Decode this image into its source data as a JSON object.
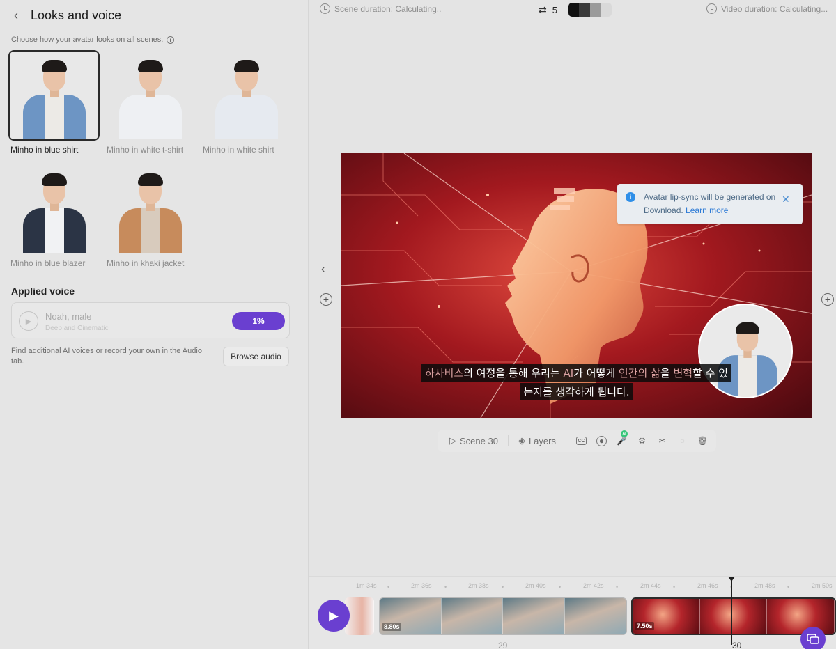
{
  "panel": {
    "title": "Looks and voice",
    "subtitle": "Choose how your avatar looks on all scenes.",
    "looks": [
      {
        "label": "Minho in blue shirt",
        "selected": true,
        "outfit": "#6d95c4",
        "inner": "#eceae6"
      },
      {
        "label": "Minho in white t-shirt",
        "selected": false,
        "outfit": "#eef0f3",
        "inner": "#eef0f3"
      },
      {
        "label": "Minho in white shirt",
        "selected": false,
        "outfit": "#e9edf2",
        "inner": "#e9edf2"
      },
      {
        "label": "Minho in blue blazer",
        "selected": false,
        "outfit": "#2b3445",
        "inner": "#f1f2f4"
      },
      {
        "label": "Minho in khaki jacket",
        "selected": false,
        "outfit": "#c78b5c",
        "inner": "#d8cbbd"
      }
    ],
    "voice_title": "Applied voice",
    "voice": {
      "name": "Noah, male",
      "description": "Deep and Cinematic",
      "progress_label": "1%"
    },
    "find_text": "Find additional AI voices or record your own in the Audio tab.",
    "browse_label": "Browse audio"
  },
  "topbar": {
    "scene_duration": "Scene duration: Calculating..",
    "shuffle_count": "5",
    "video_duration": "Video duration: Calculating...",
    "swatches": [
      "#111111",
      "#3a3a3a",
      "#9a9a9a",
      "#d9d9d9"
    ]
  },
  "toast": {
    "text": "Avatar lip-sync will be generated on Download.",
    "link": "Learn more"
  },
  "subtitles": {
    "line1_a": "하사비스",
    "line1_b": "의 여정을 통해 우리는 ",
    "line1_c": "AI",
    "line1_d": "가 어떻게 ",
    "line1_e": "인간의 삶",
    "line1_f": "을 ",
    "line1_g": "변혁",
    "line1_h": "할 수 있",
    "line2": "는지를 생각하게 됩니다."
  },
  "scene_toolbar": {
    "scene_label": "Scene 30",
    "layers_label": "Layers",
    "ai_badge": "AI"
  },
  "timeline": {
    "ticks": [
      "1m 34s",
      "2m 36s",
      "2m 38s",
      "2m 40s",
      "2m 42s",
      "2m 44s",
      "2m 46s",
      "2m 48s",
      "2m 50s"
    ],
    "clip_a_duration": "8.80s",
    "clip_b_duration": "7.50s",
    "scene_numbers": [
      "29",
      "30"
    ]
  },
  "colors": {
    "accent": "#6a3fd0",
    "info_blue": "#2f8fe8",
    "video_red": "#b5262b"
  }
}
